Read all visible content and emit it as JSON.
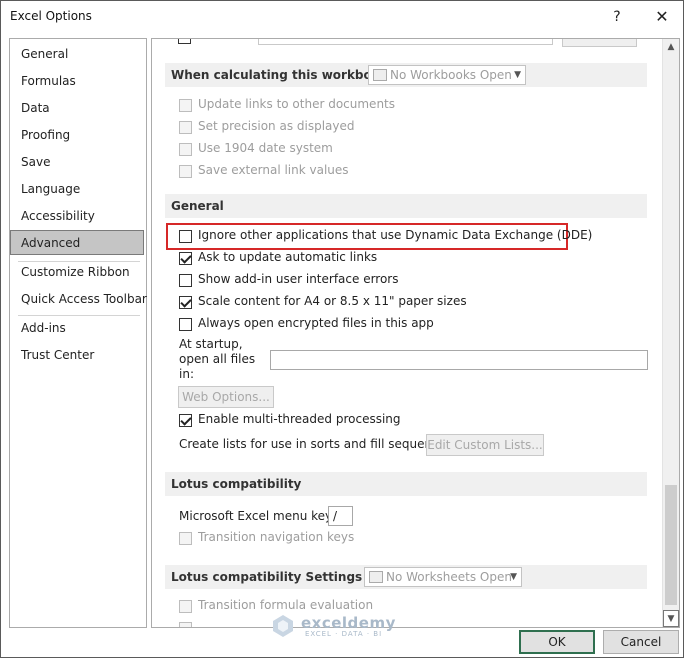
{
  "window": {
    "title": "Excel Options",
    "help_glyph": "?",
    "close_glyph": "✕"
  },
  "nav": {
    "items": [
      {
        "label": "General"
      },
      {
        "label": "Formulas"
      },
      {
        "label": "Data"
      },
      {
        "label": "Proofing"
      },
      {
        "label": "Save"
      },
      {
        "label": "Language"
      },
      {
        "label": "Accessibility"
      },
      {
        "label": "Advanced",
        "selected": true
      },
      {
        "label": "Customize Ribbon"
      },
      {
        "label": "Quick Access Toolbar"
      },
      {
        "label": "Add-ins"
      },
      {
        "label": "Trust Center"
      }
    ]
  },
  "calc_workbook": {
    "heading": "When calculating this workbook:",
    "combo_value": "No Workbooks Open",
    "options": [
      {
        "label": "Update links to other documents",
        "checked": false,
        "enabled": false
      },
      {
        "label": "Set precision as displayed",
        "checked": false,
        "enabled": false
      },
      {
        "label": "Use 1904 date system",
        "checked": false,
        "enabled": false
      },
      {
        "label": "Save external link values",
        "checked": false,
        "enabled": false
      }
    ]
  },
  "general": {
    "heading": "General",
    "options": [
      {
        "label": "Ignore other applications that use Dynamic Data Exchange (DDE)",
        "checked": false,
        "enabled": true,
        "highlighted": true
      },
      {
        "label": "Ask to update automatic links",
        "checked": true,
        "enabled": true
      },
      {
        "label": "Show add-in user interface errors",
        "checked": false,
        "enabled": true
      },
      {
        "label": "Scale content for A4 or 8.5 x 11\" paper sizes",
        "checked": true,
        "enabled": true
      },
      {
        "label": "Always open encrypted files in this app",
        "checked": false,
        "enabled": true
      }
    ],
    "startup_label_1": "At startup,",
    "startup_label_2": "open all files",
    "startup_label_3": "in:",
    "startup_value": "",
    "web_options_button": "Web Options...",
    "multithread": {
      "label": "Enable multi-threaded processing",
      "checked": true
    },
    "custom_lists_label": "Create lists for use in sorts and fill sequences:",
    "custom_lists_button": "Edit Custom Lists..."
  },
  "lotus": {
    "heading": "Lotus compatibility",
    "menu_key_label": "Microsoft Excel menu key:",
    "menu_key_value": "/",
    "transition_nav": {
      "label": "Transition navigation keys",
      "checked": false,
      "enabled": false
    }
  },
  "lotus_settings": {
    "heading": "Lotus compatibility Settings for:",
    "combo_value": "No Worksheets Open",
    "transition_formula": {
      "label": "Transition formula evaluation",
      "checked": false,
      "enabled": false
    }
  },
  "buttons": {
    "ok": "OK",
    "cancel": "Cancel"
  },
  "watermark": {
    "name": "exceldemy",
    "tagline": "EXCEL · DATA · BI"
  },
  "colors": {
    "highlight_border": "#d62828",
    "section_bg": "#f0f0f0",
    "nav_selected_bg": "#c5c5c5"
  }
}
